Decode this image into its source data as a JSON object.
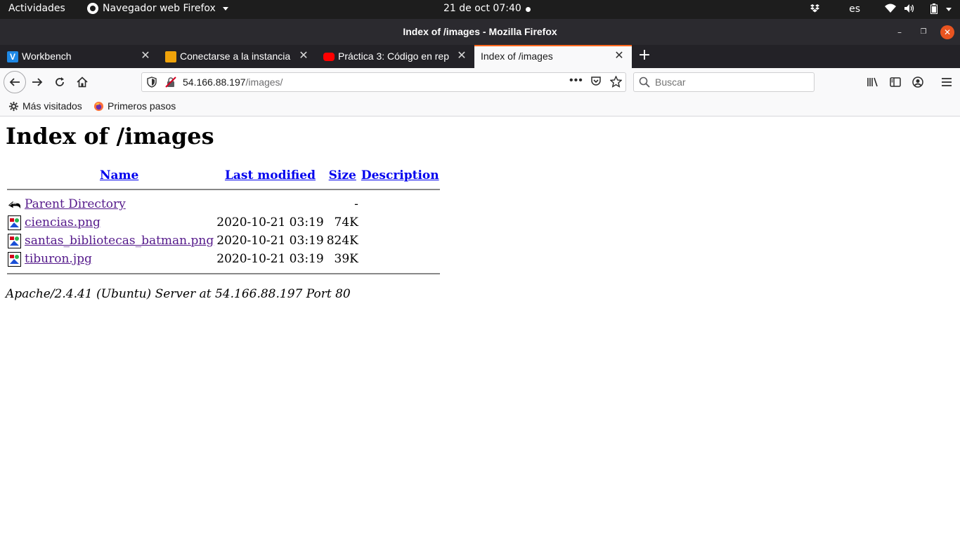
{
  "system_bar": {
    "activities": "Actividades",
    "app_menu": "Navegador web Firefox",
    "clock": "21 de oct  07:40",
    "language": "es"
  },
  "window": {
    "title": "Index of /images - Mozilla Firefox"
  },
  "tabs": [
    {
      "label": "Workbench",
      "favicon_color": "#1e88e5"
    },
    {
      "label": "Conectarse a la instancia",
      "favicon_color": "#f0a30a"
    },
    {
      "label": "Práctica 3: Código en rep",
      "favicon_color": "#ff0000"
    },
    {
      "label": "Index of /images",
      "active": true
    }
  ],
  "navigation": {
    "url_host": "54.166.88.197",
    "url_path": "/images/",
    "search_placeholder": "Buscar"
  },
  "bookmarks": [
    {
      "label": "Más visitados",
      "icon": "gear-icon"
    },
    {
      "label": "Primeros pasos",
      "icon": "firefox-icon"
    }
  ],
  "page": {
    "heading": "Index of /images",
    "columns": {
      "name": "Name",
      "last_modified": "Last modified",
      "size": "Size",
      "description": "Description"
    },
    "parent": {
      "name": "Parent Directory",
      "size": "-"
    },
    "files": [
      {
        "name": "ciencias.png",
        "modified": "2020-10-21 03:19",
        "size": "74K"
      },
      {
        "name": "santas_bibliotecas_batman.png",
        "modified": "2020-10-21 03:19",
        "size": "824K"
      },
      {
        "name": "tiburon.jpg",
        "modified": "2020-10-21 03:19",
        "size": "39K"
      }
    ],
    "server_signature": "Apache/2.4.41 (Ubuntu) Server at 54.166.88.197 Port 80"
  },
  "colors": {
    "link": "#0000ee",
    "visited_link": "#551a8b",
    "active_tab_accent": "#ff6a1f",
    "window_close": "#e95420"
  }
}
